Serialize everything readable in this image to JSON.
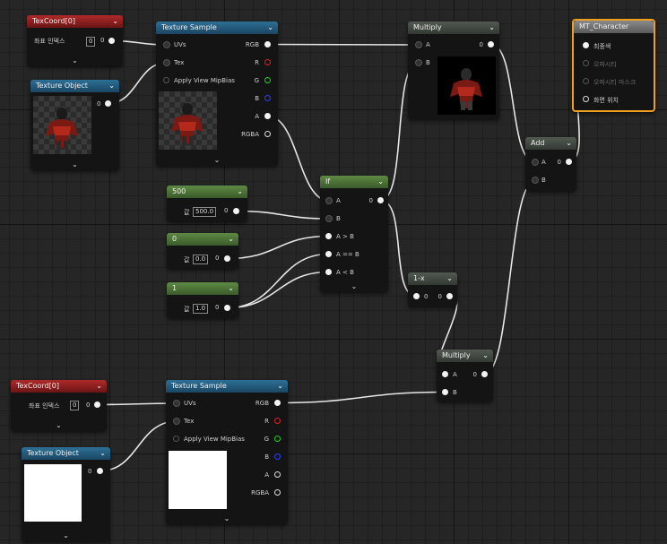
{
  "nodes": {
    "texcoord_top": {
      "title": "TexCoord[0]",
      "param_label": "좌표 인덱스",
      "param_value": "0",
      "out_label": "0"
    },
    "texobj_top": {
      "title": "Texture Object",
      "out_label": "0"
    },
    "texsample_top": {
      "title": "Texture Sample",
      "inputs": [
        "UVs",
        "Tex",
        "Apply View MipBias"
      ],
      "outputs": [
        "RGB",
        "R",
        "G",
        "B",
        "A",
        "RGBA"
      ]
    },
    "multiply_top": {
      "title": "Multiply",
      "inputs": [
        "A",
        "B"
      ],
      "out_label": "0"
    },
    "output": {
      "title": "MT_Character",
      "inputs": [
        "최종색",
        "오파시티",
        "오파시티 마스크",
        "화면 위치"
      ]
    },
    "add": {
      "title": "Add",
      "inputs": [
        "A",
        "B"
      ],
      "out_label": "0"
    },
    "const_500": {
      "title": "500",
      "param_label": "값",
      "param_value": "500.0",
      "out_label": "0"
    },
    "const_0": {
      "title": "0",
      "param_label": "값",
      "param_value": "0.0",
      "out_label": "0"
    },
    "const_1": {
      "title": "1",
      "param_label": "값",
      "param_value": "1.0",
      "out_label": "0"
    },
    "if": {
      "title": "If",
      "inputs": [
        "A",
        "B",
        "A > B",
        "A == B",
        "A < B"
      ],
      "out_label": "0"
    },
    "one_minus": {
      "title": "1-x",
      "in_label": "0",
      "out_label": "0"
    },
    "multiply_bottom": {
      "title": "Multiply",
      "inputs": [
        "A",
        "B"
      ],
      "out_label": "0"
    },
    "texcoord_bottom": {
      "title": "TexCoord[0]",
      "param_label": "좌표 인덱스",
      "param_value": "0",
      "out_label": "0"
    },
    "texsample_bottom": {
      "title": "Texture Sample",
      "inputs": [
        "UVs",
        "Tex",
        "Apply View MipBias"
      ],
      "outputs": [
        "RGB",
        "R",
        "G",
        "B",
        "A",
        "RGBA"
      ]
    },
    "texobj_bottom": {
      "title": "Texture Object",
      "out_label": "0"
    }
  },
  "icons": {
    "collapse": "chevron-down-icon",
    "expand": "chevron-down-icon"
  },
  "colors": {
    "texcoord_header": "#b02a2a",
    "texture_header": "#2d6f96",
    "constant_header": "#5e8a44",
    "math_header": "#525a52",
    "output_border": "#f0a020",
    "wire": "#e6e6e6"
  }
}
